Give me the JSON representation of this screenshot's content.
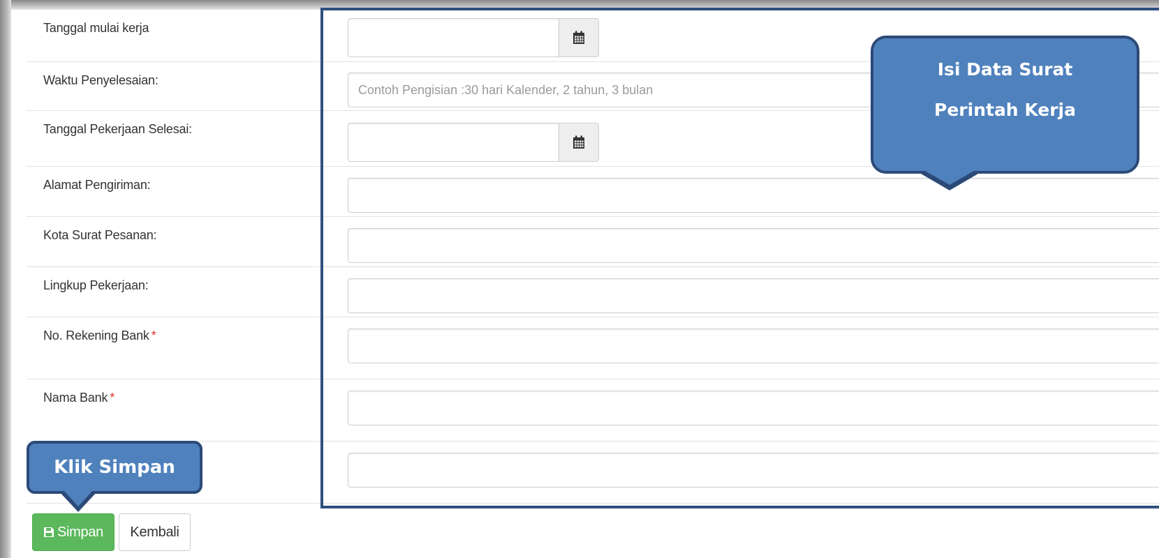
{
  "form": {
    "rows": [
      {
        "label": "Tanggal mulai kerja",
        "required": false,
        "value": "",
        "placeholder": ""
      },
      {
        "label": "Waktu Penyelesaian:",
        "required": false,
        "value": "",
        "placeholder": "Contoh Pengisian :30 hari Kalender, 2 tahun, 3 bulan"
      },
      {
        "label": "Tanggal Pekerjaan Selesai:",
        "required": false,
        "value": "",
        "placeholder": ""
      },
      {
        "label": "Alamat Pengiriman:",
        "required": false,
        "value": "",
        "placeholder": ""
      },
      {
        "label": "Kota Surat Pesanan:",
        "required": false,
        "value": "",
        "placeholder": ""
      },
      {
        "label": "Lingkup Pekerjaan:",
        "required": false,
        "value": "",
        "placeholder": ""
      },
      {
        "label": "No. Rekening Bank",
        "required": true,
        "value": "",
        "placeholder": ""
      },
      {
        "label": "Nama Bank",
        "required": true,
        "value": "",
        "placeholder": ""
      },
      {
        "label": "",
        "required": false,
        "value": "",
        "placeholder": ""
      }
    ],
    "required_mark": "*",
    "calendar_icon": "calendar-icon"
  },
  "buttons": {
    "save_label": "Simpan",
    "save_icon": "floppy-disk-icon",
    "back_label": "Kembali"
  },
  "annotations": {
    "fill_callout_line1": "Isi Data Surat",
    "fill_callout_line2": "Perintah Kerja",
    "save_callout": "Klik Simpan"
  },
  "colors": {
    "save_button": "#5cb85c",
    "callout_fill": "#4f81bd",
    "callout_border": "#2c4a78",
    "frame_border": "#2f4f7f",
    "required": "#d9362b"
  }
}
